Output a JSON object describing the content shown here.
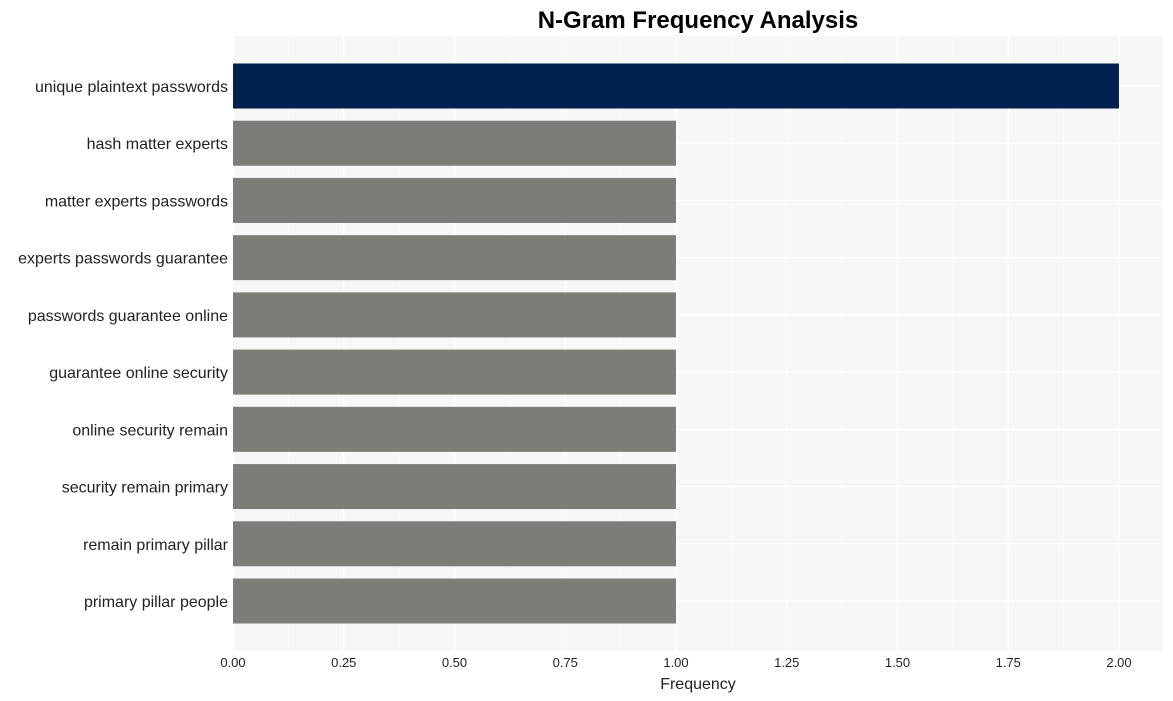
{
  "chart_data": {
    "type": "bar",
    "orientation": "horizontal",
    "title": "N-Gram Frequency Analysis",
    "xlabel": "Frequency",
    "ylabel": "",
    "xlim": [
      0,
      2.1
    ],
    "xticks": [
      0.0,
      0.25,
      0.5,
      0.75,
      1.0,
      1.25,
      1.5,
      1.75,
      2.0
    ],
    "xtick_labels": [
      "0.00",
      "0.25",
      "0.50",
      "0.75",
      "1.00",
      "1.25",
      "1.50",
      "1.75",
      "2.00"
    ],
    "grid": true,
    "categories": [
      "unique plaintext passwords",
      "hash matter experts",
      "matter experts passwords",
      "experts passwords guarantee",
      "passwords guarantee online",
      "guarantee online security",
      "online security remain",
      "security remain primary",
      "remain primary pillar",
      "primary pillar people"
    ],
    "values": [
      2,
      1,
      1,
      1,
      1,
      1,
      1,
      1,
      1,
      1
    ],
    "colors": {
      "highlight": "#00204e",
      "default": "#7d7c78",
      "plot_background": "#f7f7f7",
      "grid": "#ffffff"
    }
  }
}
